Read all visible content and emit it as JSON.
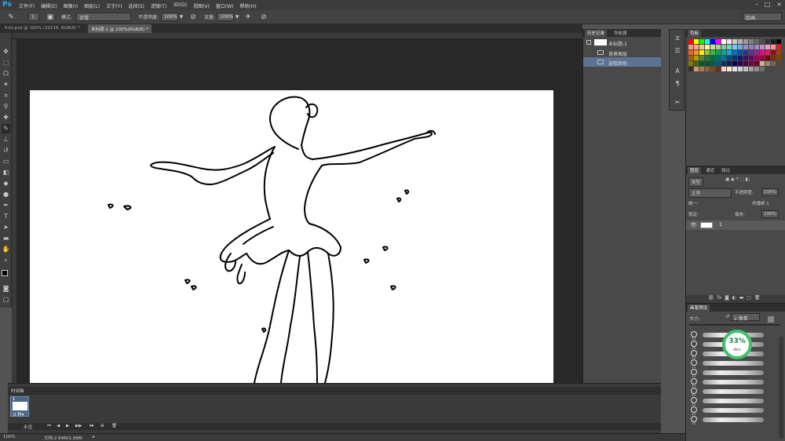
{
  "app": {
    "logo": "Ps"
  },
  "menu": [
    "文件(F)",
    "编辑(E)",
    "图像(I)",
    "图层(L)",
    "文字(Y)",
    "选择(S)",
    "滤镜(T)",
    "3D(D)",
    "视图(V)",
    "窗口(W)",
    "帮助(H)"
  ],
  "options": {
    "brush_size": "1",
    "mode_label": "模式:",
    "mode_value": "正常",
    "opacity_label": "不透明度:",
    "opacity_value": "100%",
    "flow_label": "流量:",
    "flow_value": "100%",
    "workspace": "绘画"
  },
  "tabs": [
    {
      "label": "first.psd @ 100% (22218, RGB/8) *"
    },
    {
      "label": "未标题-1 @ 100%(RGB/8) *"
    }
  ],
  "history": {
    "tabs": [
      "历史记录",
      "导航器"
    ],
    "items": [
      {
        "label": "未标题-1"
      },
      {
        "label": "背景图层"
      },
      {
        "label": "选取颜色"
      }
    ]
  },
  "swatches": {
    "tab": "色板",
    "colors": [
      "#ff0000",
      "#ffff00",
      "#00ff00",
      "#00ffff",
      "#0000ff",
      "#ff00ff",
      "#ffffff",
      "#e6e6e6",
      "#cccccc",
      "#b3b3b3",
      "#999999",
      "#808080",
      "#666666",
      "#4d4d4d",
      "#333333",
      "#1a1a1a",
      "#000000",
      "#f7977a",
      "#f9ad81",
      "#fdc68a",
      "#fff79a",
      "#c4df9b",
      "#a2d39c",
      "#82ca9d",
      "#7bcdc8",
      "#6ecff6",
      "#7ea7d8",
      "#8493ca",
      "#8882be",
      "#a187be",
      "#bc8dbf",
      "#f49ac2",
      "#f6989d",
      "#ed1c24",
      "#f26522",
      "#f7941d",
      "#fff200",
      "#8dc63f",
      "#39b54a",
      "#00a651",
      "#00a99d",
      "#00aeef",
      "#0072bc",
      "#0054a6",
      "#2e3192",
      "#662d91",
      "#92278f",
      "#ec008c",
      "#ed145b",
      "#9e0b0f",
      "#a0410d",
      "#a36209",
      "#aba000",
      "#598527",
      "#1a7b30",
      "#007236",
      "#00746b",
      "#0076a3",
      "#004b80",
      "#003471",
      "#1b1464",
      "#440e62",
      "#630460",
      "#9e005d",
      "#9e0039",
      "#790000",
      "#7b2e00",
      "#7d4900",
      "#827b00",
      "#406618",
      "#005e20",
      "#005826",
      "#005952",
      "#005b7f",
      "#003663",
      "#002157",
      "#0d004c",
      "#32004b",
      "#4b0049",
      "#7b0046",
      "#7a0026",
      "#c7b299",
      "#998675",
      "#736357",
      "#534741",
      "#37302d",
      "#c69c6d",
      "#a67c52",
      "#8c6239",
      "#754c24",
      "#603913",
      "#ffcccc",
      "#ffe5cc",
      "#e0e0e0",
      "#d0d0d0",
      "#c0c0c0",
      "#a0a0a0",
      "#909090",
      "#707070"
    ]
  },
  "layers": {
    "tabs": [
      "图层",
      "通道",
      "路径"
    ],
    "kind_label": "类型",
    "blend": "正常",
    "opacity_label": "不透明度:",
    "opacity_value": "100%",
    "lock_label": "锁定:",
    "fill_label": "填充:",
    "fill_value": "100%",
    "propagate": "传播帧 1",
    "unify": "统一:",
    "layer_name": "1"
  },
  "brush": {
    "tab": "画笔预设",
    "size_label": "大小:",
    "size_value": "2 像素",
    "sizes": [
      "13",
      "19",
      "30",
      "23",
      "33",
      "33",
      "40",
      "32",
      "24",
      "34"
    ]
  },
  "network": {
    "percent": "33%",
    "rate": "0K/s"
  },
  "timeline": {
    "title": "时间轴",
    "frame_num": "1",
    "frame_duration": "0 秒▾",
    "loop": "永远"
  },
  "status": {
    "zoom": "100%",
    "doc": "文档:2.64M/1.88M"
  }
}
